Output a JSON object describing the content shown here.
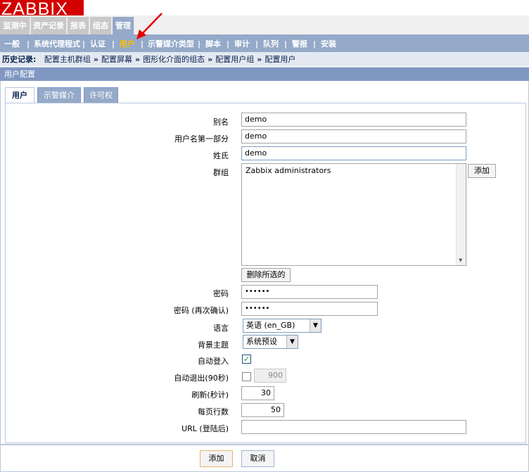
{
  "logo": "ZABBIX",
  "main_menu": [
    "监测中",
    "资产记录",
    "报表",
    "组态",
    "管理"
  ],
  "sub_menu": [
    "一般",
    "系统代理程式",
    "认证",
    "用户",
    "示警媒介类型",
    "脚本",
    "审计",
    "队列",
    "警报",
    "安装"
  ],
  "history": {
    "label": "历史记录:",
    "items": [
      "配置主机群组",
      "配置屏幕",
      "图形化介面的组态",
      "配置用户组",
      "配置用户"
    ],
    "sep": "»"
  },
  "title": "用户配置",
  "tabs": [
    "用户",
    "示警媒介",
    "许可权"
  ],
  "form": {
    "alias_label": "别名",
    "alias_value": "demo",
    "name_label": "用户名第一部分",
    "name_value": "demo",
    "surname_label": "姓氏",
    "surname_value": "demo",
    "groups_label": "群组",
    "groups_items": [
      "Zabbix administrators"
    ],
    "groups_add": "添加",
    "groups_remove": "删除所选的",
    "password_label": "密码",
    "password_value": "••••••",
    "password2_label": "密码 (再次确认)",
    "password2_value": "••••••",
    "language_label": "语言",
    "language_value": "英语 (en_GB)",
    "theme_label": "背景主题",
    "theme_value": "系统预设",
    "autologin_label": "自动登入",
    "autologin_checked": true,
    "autologout_label": "自动退出(90秒)",
    "autologout_checked": false,
    "autologout_value": "900",
    "refresh_label": "刷新(秒计)",
    "refresh_value": "30",
    "rows_label": "每页行数",
    "rows_value": "50",
    "url_label": "URL (登陆后)",
    "url_value": ""
  },
  "footer": {
    "add": "添加",
    "cancel": "取消"
  },
  "colors": {
    "logo": "#d40000",
    "menu_active": "#95a9c9",
    "submenu_active": "#ffc000",
    "title_bar": "#8097c2",
    "annotation_arrow": "#e60000"
  }
}
